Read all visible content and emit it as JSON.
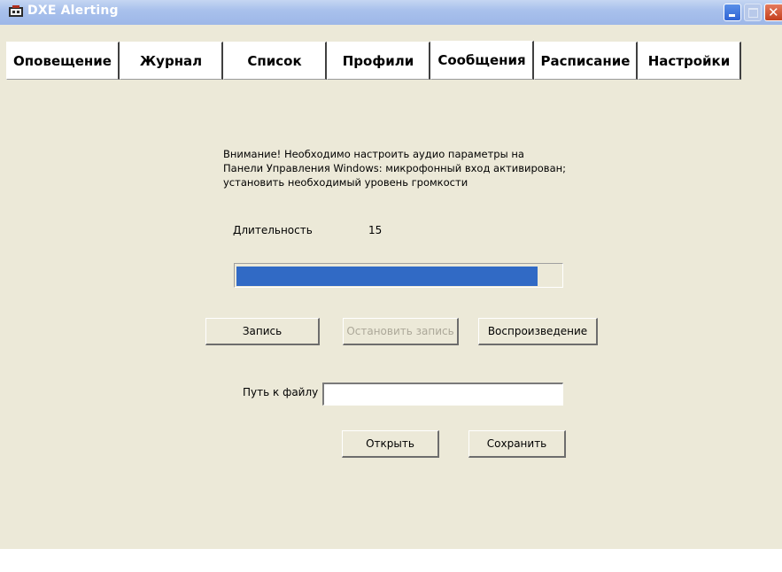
{
  "window": {
    "title": "DXE Alerting"
  },
  "tabs": [
    {
      "label": "Оповещение",
      "active": false
    },
    {
      "label": "Журнал",
      "active": false
    },
    {
      "label": "Список",
      "active": false
    },
    {
      "label": "Профили",
      "active": false
    },
    {
      "label": "Сообщения",
      "active": true
    },
    {
      "label": "Расписание",
      "active": false
    },
    {
      "label": "Настройки",
      "active": false
    }
  ],
  "notice": {
    "lines": [
      "Внимание! Необходимо настроить аудио параметры на",
      "Панели Управления Windows: микрофонный вход активирован;",
      "установить необходимый уровень громкости"
    ]
  },
  "duration": {
    "label": "Длительность",
    "value": "15"
  },
  "progress": {
    "fraction": 0.93,
    "color": "#316ac5"
  },
  "buttons": {
    "record": "Запись",
    "stop_record": "Остановить запись",
    "playback": "Воспроизведение",
    "open": "Открыть",
    "save": "Сохранить"
  },
  "file_path": {
    "label": "Путь к файлу",
    "value": ""
  }
}
